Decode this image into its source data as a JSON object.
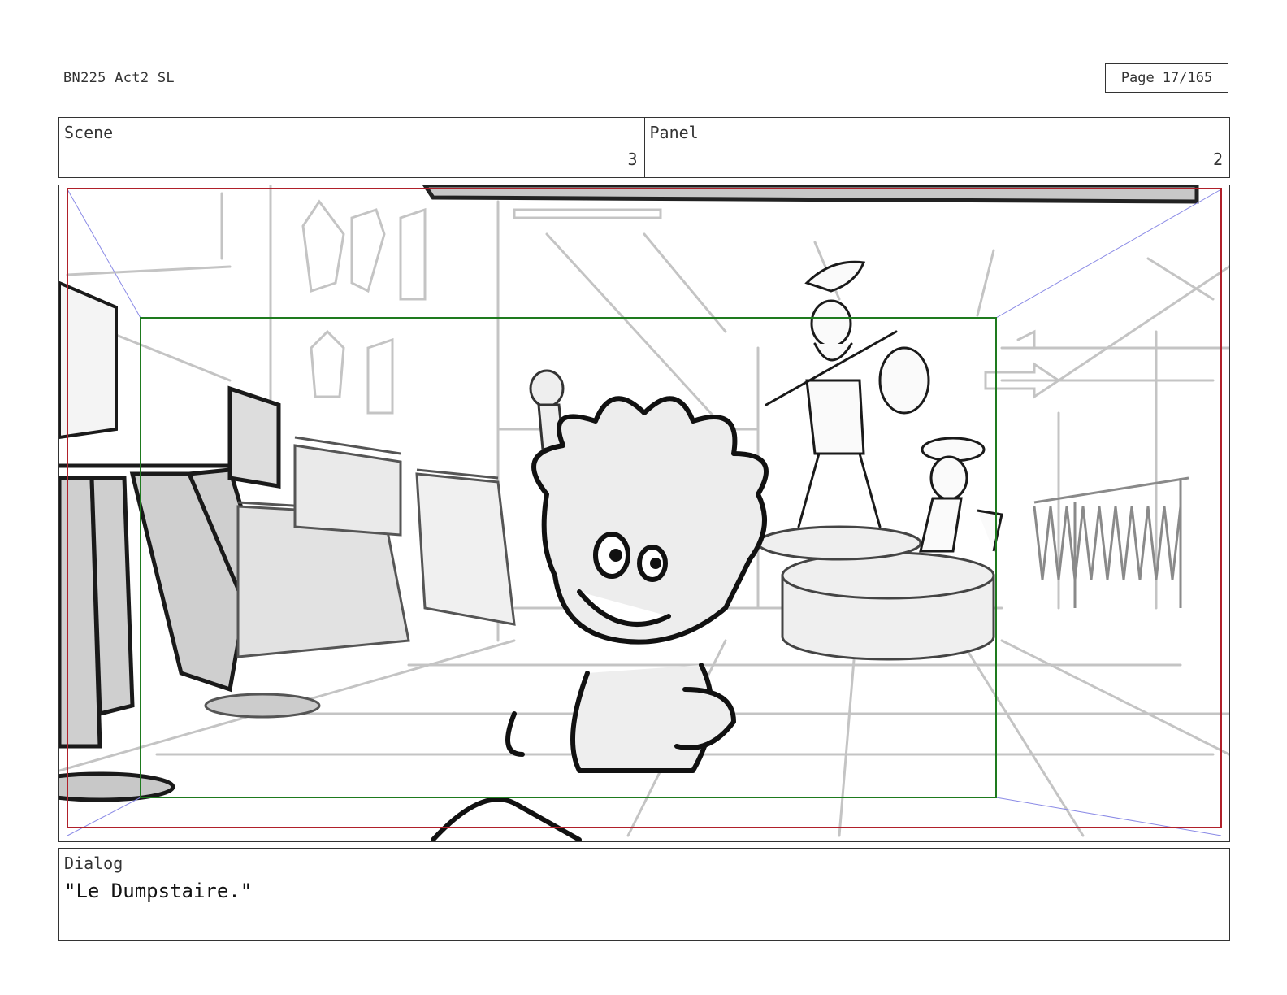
{
  "header": {
    "doc_title": "BN225 Act2 SL",
    "page_label": "Page",
    "page_number": "17/165"
  },
  "scene": {
    "label": "Scene",
    "value": "3"
  },
  "panel": {
    "label": "Panel",
    "value": "2"
  },
  "dialog": {
    "label": "Dialog",
    "text": "\"Le Dumpstaire.\""
  },
  "colors": {
    "border": "#333333",
    "safe_frame": "#1e7a1e",
    "camera_frame": "#b0202a",
    "perspective_guides": "#8a8ae6",
    "sketch_light": "#b8b8b8",
    "sketch_dark": "#1a1a1a"
  }
}
